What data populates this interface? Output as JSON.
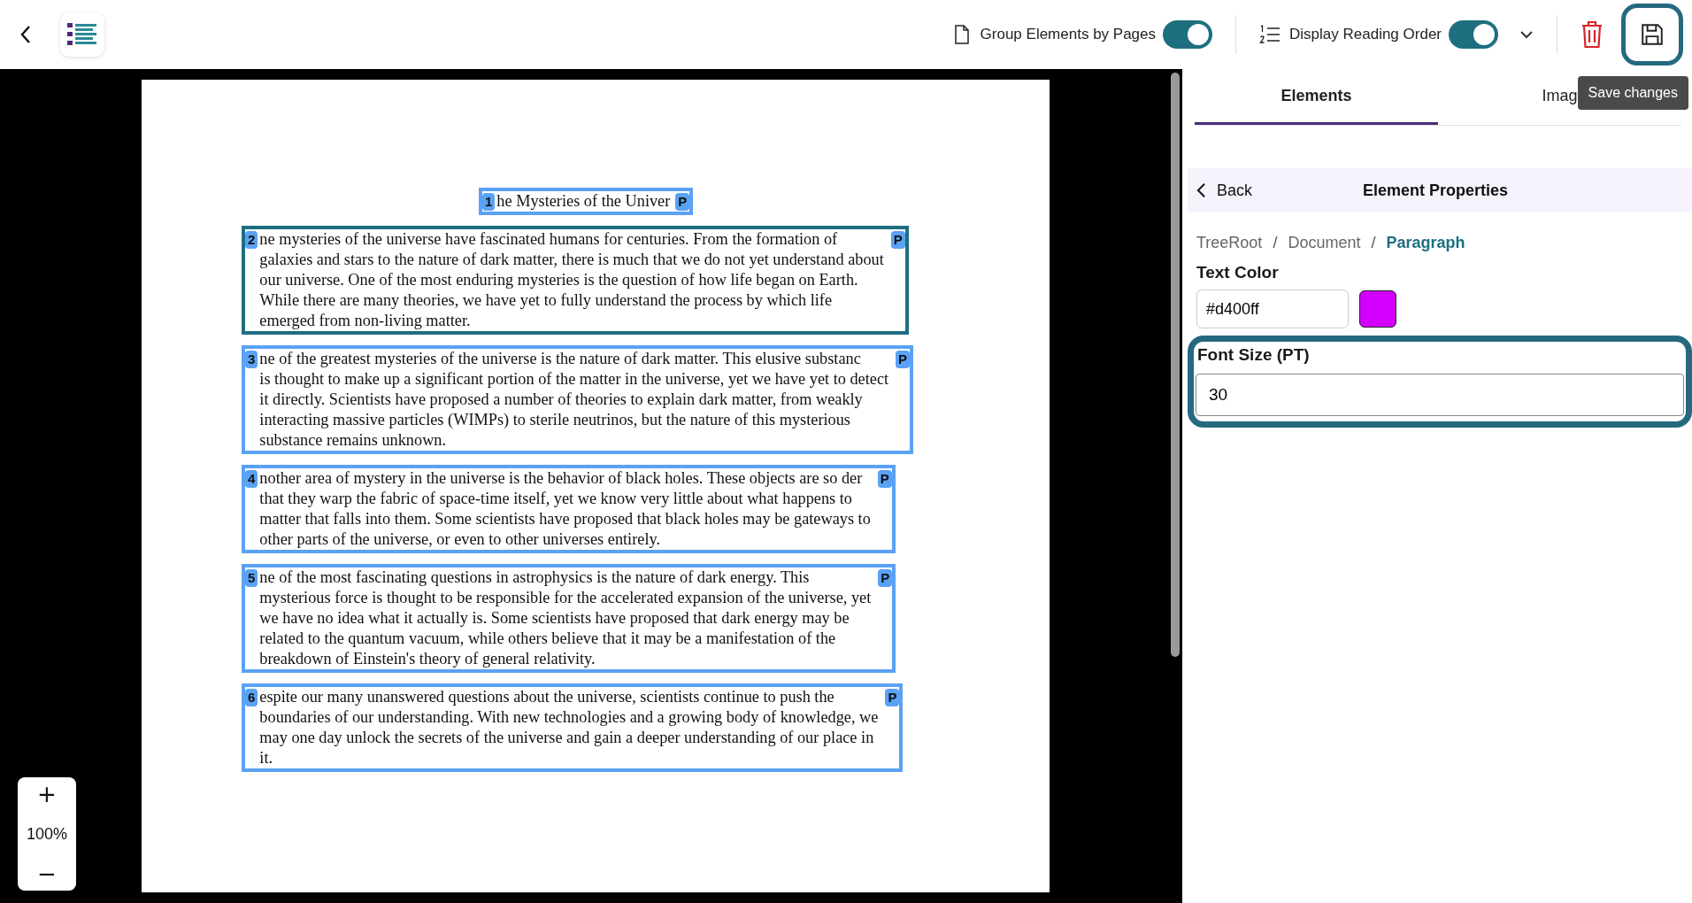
{
  "toolbar": {
    "group_by_pages": {
      "label": "Group Elements by Pages",
      "on": true
    },
    "reading_order": {
      "label": "Display Reading Order",
      "on": true
    },
    "tooltip": "Save changes"
  },
  "document": {
    "elements": [
      {
        "kind": "heading",
        "number": "1",
        "tag": "P",
        "selected": false,
        "lines": [
          "he Mysteries of the Univer"
        ]
      },
      {
        "kind": "paragraph",
        "number": "2",
        "tag": "P",
        "selected": true,
        "lines": [
          "ne mysteries of the universe have fascinated humans for centuries. From the formation of",
          "galaxies and stars to the nature of dark matter, there is much that we do not yet understand about",
          "our universe. One of the most enduring mysteries is the question of how life began on Earth.",
          "While there are many theories, we have yet to fully understand the process by which life",
          "emerged from non-living matter."
        ]
      },
      {
        "kind": "paragraph",
        "number": "3",
        "tag": "P",
        "selected": false,
        "lines": [
          "ne of the greatest mysteries of the universe is the nature of dark matter. This elusive substanc",
          "is thought to make up a significant portion of the matter in the universe, yet we have yet to detect",
          "it directly. Scientists have proposed a number of theories to explain dark matter, from weakly",
          "interacting massive particles (WIMPs) to sterile neutrinos, but the nature of this mysterious",
          "substance remains unknown."
        ]
      },
      {
        "kind": "paragraph",
        "number": "4",
        "tag": "P",
        "selected": false,
        "lines": [
          "nother area of mystery in the universe is the behavior of black holes. These objects are so der",
          "that they warp the fabric of space-time itself, yet we know very little about what happens to",
          "matter that falls into them. Some scientists have proposed that black holes may be gateways to",
          "other parts of the universe, or even to other universes entirely."
        ]
      },
      {
        "kind": "paragraph",
        "number": "5",
        "tag": "P",
        "selected": false,
        "lines": [
          "ne of the most fascinating questions in astrophysics is the nature of dark energy. This",
          "mysterious force is thought to be responsible for the accelerated expansion of the universe, yet",
          "we have no idea what it actually is. Some scientists have proposed that dark energy may be",
          "related to the quantum vacuum, while others believe that it may be a manifestation of the",
          "breakdown of Einstein's theory of general relativity."
        ]
      },
      {
        "kind": "paragraph",
        "number": "6",
        "tag": "P",
        "selected": false,
        "lines": [
          "espite our many unanswered questions about the universe, scientists continue to push the",
          "boundaries of our understanding. With new technologies and a growing body of knowledge, we",
          "may one day unlock the secrets of the universe and gain a deeper understanding of our place in",
          "it."
        ]
      }
    ]
  },
  "zoom": {
    "plus": "+",
    "level": "100%",
    "minus": "−"
  },
  "panel": {
    "tabs": [
      {
        "label": "Elements",
        "selected": true
      },
      {
        "label": "Imag",
        "selected": false
      }
    ],
    "back": "Back",
    "title": "Element Properties",
    "breadcrumb": [
      {
        "label": "TreeRoot",
        "current": false
      },
      {
        "label": "Document",
        "current": false
      },
      {
        "label": "Paragraph",
        "current": true
      }
    ],
    "breadcrumb_separator": "/",
    "text_color": {
      "label": "Text Color",
      "value": "#d400ff",
      "color": "#d400ff"
    },
    "font_size": {
      "label": "Font Size (PT)",
      "value": "30"
    }
  }
}
